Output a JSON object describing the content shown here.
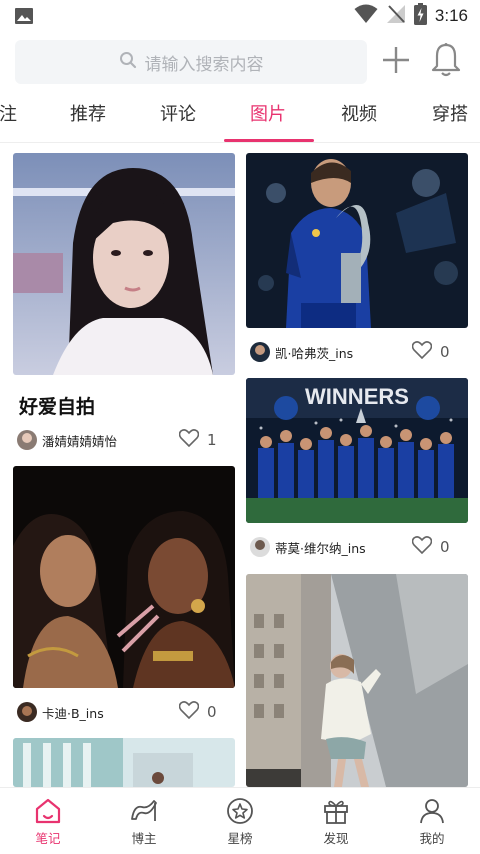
{
  "status_bar": {
    "time": "3:16"
  },
  "search": {
    "placeholder": "请输入搜索内容"
  },
  "tabs": [
    {
      "label": "注"
    },
    {
      "label": "推荐"
    },
    {
      "label": "评论"
    },
    {
      "label": "图片",
      "active": true
    },
    {
      "label": "视频"
    },
    {
      "label": "穿搭"
    }
  ],
  "feed": {
    "left": [
      {
        "title": "好爱自拍",
        "author": "潘婧婧婧婧怡",
        "likes": "1",
        "image": "selfie-photo"
      },
      {
        "author": "卡迪·B_ins",
        "likes": "0",
        "image": "duo-portrait-photo"
      },
      {
        "image": "city-building-photo"
      }
    ],
    "right": [
      {
        "author": "凯·哈弗茨_ins",
        "likes": "0",
        "image": "trophy-player-photo"
      },
      {
        "author": "蒂莫·维尔纳_ins",
        "likes": "0",
        "image": "team-celebration-photo",
        "banner_text": "WINNERS"
      },
      {
        "image": "street-pose-photo"
      }
    ]
  },
  "bottom_nav": [
    {
      "label": "笔记",
      "icon": "home-icon",
      "active": true
    },
    {
      "label": "博主",
      "icon": "heel-icon"
    },
    {
      "label": "星榜",
      "icon": "star-badge-icon"
    },
    {
      "label": "发现",
      "icon": "gift-icon"
    },
    {
      "label": "我的",
      "icon": "person-icon"
    }
  ],
  "colors": {
    "accent": "#e8336f",
    "muted_text": "#b0b3b8",
    "search_bg": "#f3f5f7"
  }
}
